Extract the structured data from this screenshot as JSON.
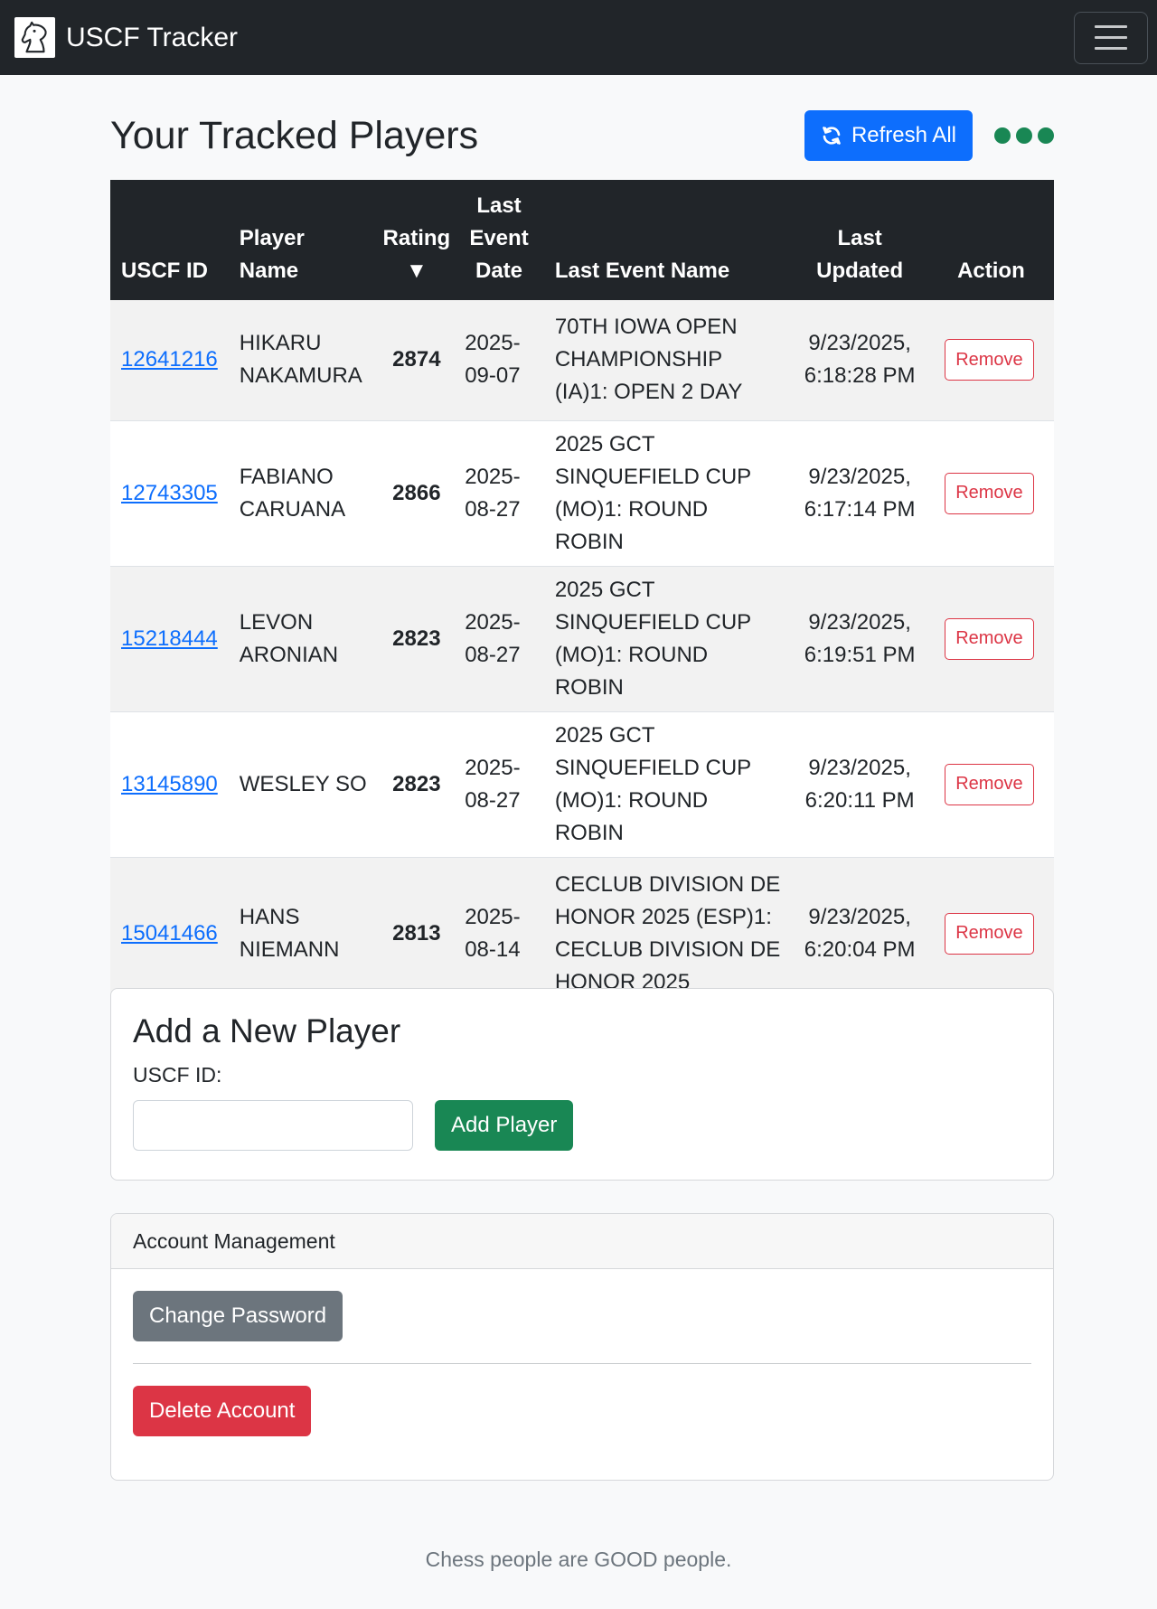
{
  "app": {
    "brand": "USCF Tracker"
  },
  "header": {
    "title": "Your Tracked Players",
    "refresh_label": "Refresh All"
  },
  "table": {
    "columns": {
      "id": "USCF ID",
      "name": "Player Name",
      "rating": "Rating ▼",
      "date": "Last Event Date",
      "event": "Last Event Name",
      "updated": "Last Updated",
      "action": "Action"
    },
    "rows": [
      {
        "id": "12641216",
        "name": "HIKARU NAKAMURA",
        "rating": "2874",
        "date": "2025-09-07",
        "event": "70TH IOWA OPEN CHAMPIONSHIP (IA)1: OPEN 2 DAY",
        "updated": "9/23/2025, 6:18:28 PM",
        "action": "Remove"
      },
      {
        "id": "12743305",
        "name": "FABIANO CARUANA",
        "rating": "2866",
        "date": "2025-08-27",
        "event": "2025 GCT SINQUEFIELD CUP (MO)1: ROUND ROBIN",
        "updated": "9/23/2025, 6:17:14 PM",
        "action": "Remove"
      },
      {
        "id": "15218444",
        "name": "LEVON ARONIAN",
        "rating": "2823",
        "date": "2025-08-27",
        "event": "2025 GCT SINQUEFIELD CUP (MO)1: ROUND ROBIN",
        "updated": "9/23/2025, 6:19:51 PM",
        "action": "Remove"
      },
      {
        "id": "13145890",
        "name": "WESLEY SO",
        "rating": "2823",
        "date": "2025-08-27",
        "event": "2025 GCT SINQUEFIELD CUP (MO)1: ROUND ROBIN",
        "updated": "9/23/2025, 6:20:11 PM",
        "action": "Remove"
      },
      {
        "id": "15041466",
        "name": "HANS NIEMANN",
        "rating": "2813",
        "date": "2025-08-14",
        "event": "CECLUB DIVISION DE HONOR 2025 (ESP)1: CECLUB DIVISION DE HONOR 2025",
        "updated": "9/23/2025, 6:20:04 PM",
        "action": "Remove"
      }
    ]
  },
  "add_player": {
    "title": "Add a New Player",
    "label": "USCF ID:",
    "input_value": "",
    "button": "Add Player"
  },
  "account": {
    "title": "Account Management",
    "change_password": "Change Password",
    "delete_account": "Delete Account"
  },
  "footer": {
    "text": "Chess people are GOOD people."
  },
  "colors": {
    "navbar": "#212529",
    "primary": "#0d6efd",
    "success": "#198754",
    "danger": "#dc3545",
    "secondary": "#6c757d"
  },
  "icons": {
    "brand": "chess-knight-icon",
    "menu": "hamburger-icon",
    "refresh": "refresh-icon",
    "status": "loading-dots-icon"
  }
}
